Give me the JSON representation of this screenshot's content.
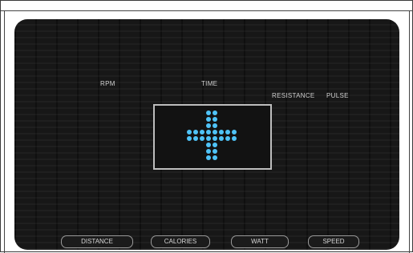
{
  "top_label": "",
  "labels": {
    "rpm": "RPM",
    "time": "TIME",
    "resistance": "RESISTANCE",
    "pulse": "PULSE"
  },
  "buttons": {
    "distance": "DISTANCE",
    "calories": "CALORIES",
    "watt": "WATT",
    "speed": "SPEED"
  },
  "colors": {
    "accent": "#4fc3f7",
    "console_bg": "#171717"
  },
  "icons": {
    "center": "plus-cross-dot-icon"
  }
}
